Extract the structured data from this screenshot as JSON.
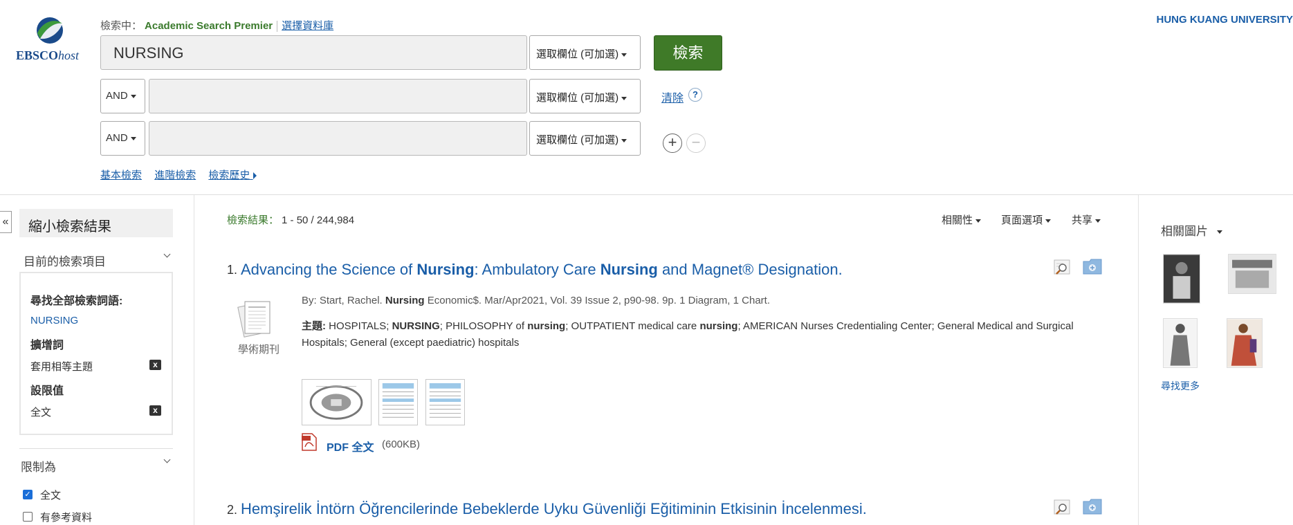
{
  "header": {
    "logo_text": "EBSCO",
    "logo_text_suffix": "host",
    "searching_label": "檢索中：",
    "database": "Academic Search Premier",
    "choose_db": "選擇資料庫",
    "university": "HUNG KUANG UNIVERSITY"
  },
  "search": {
    "rows": [
      {
        "value": "NURSING",
        "field": "選取欄位 (可加選)"
      },
      {
        "operator": "AND",
        "value": "",
        "field": "選取欄位 (可加選)"
      },
      {
        "operator": "AND",
        "value": "",
        "field": "選取欄位 (可加選)"
      }
    ],
    "search_button": "檢索",
    "clear": "清除",
    "help": "?",
    "add_icon": "+",
    "remove_icon": "−",
    "links": [
      "基本檢索",
      "進階檢索",
      "檢索歷史"
    ]
  },
  "sidebar": {
    "collapse": "«",
    "refine_title": "縮小檢索結果",
    "current_search_header": "目前的檢索項目",
    "find_all_label": "尋找全部檢索詞語:",
    "find_all_value": "NURSING",
    "expanders_label": "擴增詞",
    "expander_value": "套用相等主題",
    "limiters_label": "設限值",
    "limiter_value": "全文",
    "remove_x": "x",
    "limit_to_header": "限制為",
    "checkboxes": [
      {
        "label": "全文",
        "checked": true
      },
      {
        "label": "有參考資料",
        "checked": false
      }
    ]
  },
  "results": {
    "count_label": "檢索結果：",
    "count_value": "1 - 50 / 244,984",
    "relevance": "相關性",
    "page_options": "頁面選項",
    "share": "共享",
    "items": [
      {
        "number": "1.",
        "title_parts": [
          "Advancing the Science of ",
          "Nursing",
          ": Ambulatory Care ",
          "Nursing",
          " and Magnet® Designation."
        ],
        "byline_prefix": "By: Start, Rachel. ",
        "byline_bold": "Nursing",
        "byline_suffix": " Economic$. Mar/Apr2021, Vol. 39 Issue 2, p90-98. 9p. 1 Diagram, 1 Chart.",
        "subjects_label": "主題:",
        "subjects_parts": [
          " HOSPITALS; ",
          "NURSING",
          "; PHILOSOPHY of ",
          "nursing",
          "; OUTPATIENT medical care ",
          "nursing",
          "; AMERICAN Nurses Credentialing Center; General Medical and Surgical Hospitals; General (except paediatric) hospitals"
        ],
        "doc_type": "學術期刊",
        "pdf_label": "PDF 全文",
        "pdf_size": "(600KB)"
      },
      {
        "number": "2.",
        "title": "Hemşirelik İntörn Öğrencilerinde Bebeklerde Uyku Güvenliği Eğitiminin Etkisinin İncelenmesi."
      }
    ]
  },
  "related_images": {
    "title": "相關圖片",
    "find_more": "尋找更多"
  },
  "colors": {
    "link": "#1a5ea8",
    "green": "#3f7a28",
    "db_green": "#3a7a2c"
  }
}
